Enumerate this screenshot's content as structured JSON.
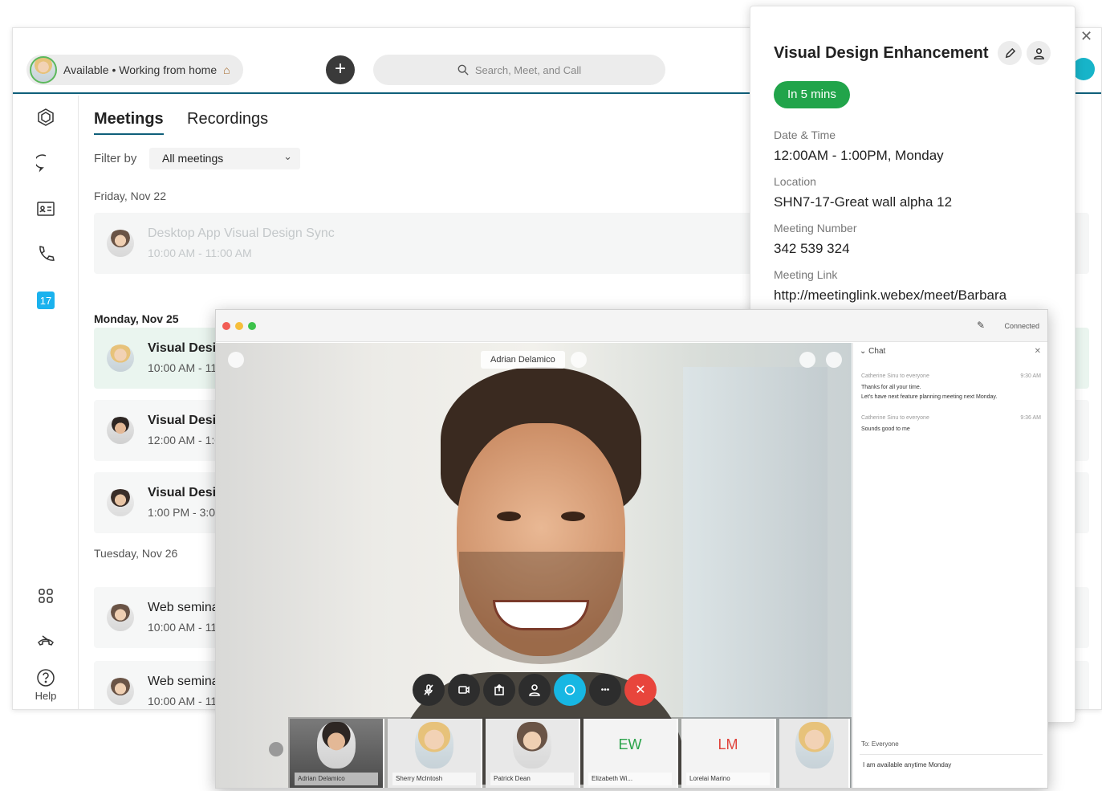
{
  "topbar": {
    "status": "Available • Working from home",
    "status_icon": "house-emoji",
    "search_placeholder": "Search, Meet, and Call",
    "add_icon": "plus-icon"
  },
  "sidebar": {
    "items": [
      {
        "icon": "teams-hexagon-icon"
      },
      {
        "icon": "message-bubble-icon"
      },
      {
        "icon": "contact-card-icon"
      },
      {
        "icon": "phone-icon"
      },
      {
        "icon": "calendar-icon",
        "label": "17",
        "active": true
      }
    ],
    "bottom": [
      {
        "icon": "apps-grid-icon"
      },
      {
        "icon": "call-settings-icon"
      },
      {
        "icon": "help-icon",
        "label": "Help"
      }
    ]
  },
  "meetings": {
    "tabs": [
      {
        "label": "Meetings"
      },
      {
        "label": "Recordings"
      }
    ],
    "filter_label": "Filter by",
    "filter_value": "All meetings",
    "days": [
      {
        "label": "Friday, Nov 22"
      },
      {
        "label": "Monday, Nov 25"
      },
      {
        "label": "Tuesday, Nov 26"
      }
    ],
    "rows": [
      {
        "title": "Desktop App Visual Design Sync",
        "time": "10:00 AM - 11:00 AM"
      },
      {
        "title": "Visual Desig",
        "time": "10:00 AM - 11:"
      },
      {
        "title": "Visual Desig",
        "time": "12:00 AM - 1:0"
      },
      {
        "title": "Visual Desig",
        "time": "1:00 PM - 3:00"
      },
      {
        "title": "Web seminar",
        "time": "10:00 AM - 11:"
      },
      {
        "title": "Web seminar",
        "time": "10:00 AM - 11:"
      }
    ]
  },
  "detail": {
    "title": "Visual Design Enhancement",
    "badge": "In 5 mins",
    "fields": [
      {
        "label": "Date & Time",
        "value": "12:00AM - 1:00PM, Monday"
      },
      {
        "label": "Location",
        "value": "SHN7-17-Great wall alpha 12"
      },
      {
        "label": "Meeting Number",
        "value": "342 539 324"
      },
      {
        "label": "Meeting Link",
        "value": "http://meetinglink.webex/meet/Barbara"
      }
    ],
    "accent": "#21a44a"
  },
  "video": {
    "speaker": "Adrian Delamico",
    "status": "Connected",
    "thumbnails": [
      {
        "name": "Adrian Delamico"
      },
      {
        "name": "Sherry McIntosh"
      },
      {
        "name": "Patrick Dean"
      },
      {
        "initials": "EW",
        "name": "Elizabeth Wi..."
      },
      {
        "initials": "LM",
        "name": "Lorelai Marino"
      },
      {
        "name": ""
      }
    ],
    "controls": [
      "mute-icon",
      "video-icon",
      "share-icon",
      "participants-icon",
      "chat-icon",
      "more-icon",
      "end-call-icon"
    ],
    "end_color": "#e8453c",
    "chat_color": "#17b7e3"
  },
  "chat": {
    "title": "Chat",
    "messages": [
      {
        "sender": "Catherine Sinu to everyone",
        "time": "9:30 AM",
        "lines": [
          "Thanks for all your time.",
          "Let's have next feature planning meeting next Monday."
        ]
      },
      {
        "sender": "Catherine Sinu to everyone",
        "time": "9:36 AM",
        "lines": [
          "Sounds good to me"
        ]
      }
    ],
    "to": "To: Everyone",
    "draft": "I am available anytime Monday"
  }
}
